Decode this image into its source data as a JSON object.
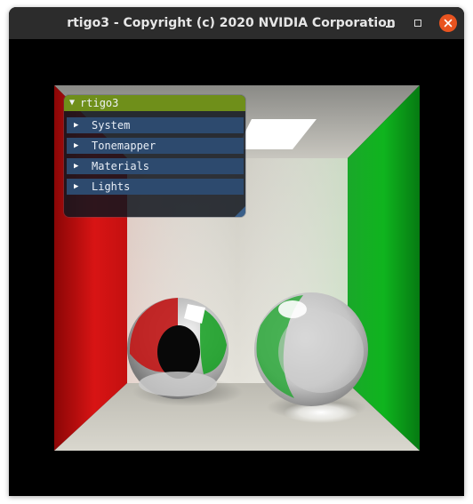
{
  "window": {
    "title": "rtigo3 - Copyright (c) 2020 NVIDIA Corporation",
    "buttons": [
      "minimize-icon",
      "maximize-icon",
      "close-icon"
    ],
    "close_color": "#e95420"
  },
  "gui": {
    "title": "rtigo3",
    "title_bar_color": "#6f8f1a",
    "header_color": "#2d4a6e",
    "sections": [
      "System",
      "Tonemapper",
      "Materials",
      "Lights"
    ]
  },
  "scene": {
    "left_wall_color": "#c81010",
    "right_wall_color": "#10b020",
    "back_wall_color": "#d8d6cc"
  }
}
